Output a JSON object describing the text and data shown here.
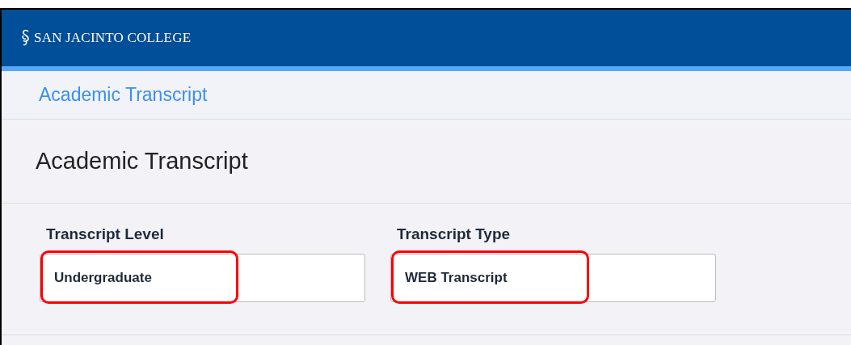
{
  "header": {
    "logo_text": "SAN JACINTO COLLEGE"
  },
  "breadcrumb": "Academic Transcript",
  "page_title": "Academic Transcript",
  "fields": [
    {
      "label": "Transcript Level",
      "value": "Undergraduate",
      "highlighted": true
    },
    {
      "label": "Transcript Type",
      "value": "WEB Transcript",
      "highlighted": true
    }
  ]
}
